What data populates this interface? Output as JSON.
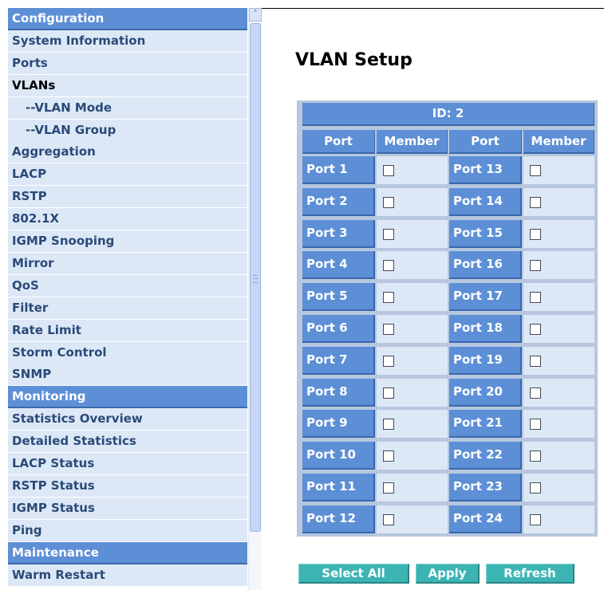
{
  "sidebar": {
    "rows": [
      {
        "label": "Configuration",
        "type": "section"
      },
      {
        "label": "System Information",
        "type": "item"
      },
      {
        "label": "Ports",
        "type": "item"
      },
      {
        "label": "VLANs",
        "type": "active"
      },
      {
        "label": "--VLAN Mode",
        "type": "sub"
      },
      {
        "label": "--VLAN Group",
        "type": "sub"
      },
      {
        "label": "Aggregation",
        "type": "item"
      },
      {
        "label": "LACP",
        "type": "item"
      },
      {
        "label": "RSTP",
        "type": "item"
      },
      {
        "label": "802.1X",
        "type": "item"
      },
      {
        "label": "IGMP Snooping",
        "type": "item"
      },
      {
        "label": "Mirror",
        "type": "item"
      },
      {
        "label": "QoS",
        "type": "item"
      },
      {
        "label": "Filter",
        "type": "item"
      },
      {
        "label": "Rate Limit",
        "type": "item"
      },
      {
        "label": "Storm Control",
        "type": "item"
      },
      {
        "label": "SNMP",
        "type": "item"
      },
      {
        "label": "Monitoring",
        "type": "section"
      },
      {
        "label": "Statistics Overview",
        "type": "item"
      },
      {
        "label": "Detailed Statistics",
        "type": "item"
      },
      {
        "label": "LACP Status",
        "type": "item"
      },
      {
        "label": "RSTP Status",
        "type": "item"
      },
      {
        "label": "IGMP Status",
        "type": "item"
      },
      {
        "label": "Ping",
        "type": "item"
      },
      {
        "label": "Maintenance",
        "type": "section"
      },
      {
        "label": "Warm Restart",
        "type": "item"
      }
    ]
  },
  "page": {
    "title": "VLAN Setup"
  },
  "vlan_table": {
    "id_header": "ID: 2",
    "columns": [
      "Port",
      "Member",
      "Port",
      "Member"
    ],
    "left_ports": [
      "Port 1",
      "Port 2",
      "Port 3",
      "Port 4",
      "Port 5",
      "Port 6",
      "Port 7",
      "Port 8",
      "Port 9",
      "Port 10",
      "Port 11",
      "Port 12"
    ],
    "right_ports": [
      "Port 13",
      "Port 14",
      "Port 15",
      "Port 16",
      "Port 17",
      "Port 18",
      "Port 19",
      "Port 20",
      "Port 21",
      "Port 22",
      "Port 23",
      "Port 24"
    ],
    "left_members": [
      false,
      false,
      false,
      false,
      false,
      false,
      false,
      false,
      false,
      false,
      false,
      false
    ],
    "right_members": [
      false,
      false,
      false,
      false,
      false,
      false,
      false,
      false,
      false,
      false,
      false,
      false
    ]
  },
  "buttons": {
    "select_all": "Select All",
    "apply": "Apply",
    "refresh": "Refresh"
  },
  "colors": {
    "header_blue": "#5d8fd6",
    "row_light": "#dde8f7",
    "button_teal": "#3cb4b4"
  }
}
